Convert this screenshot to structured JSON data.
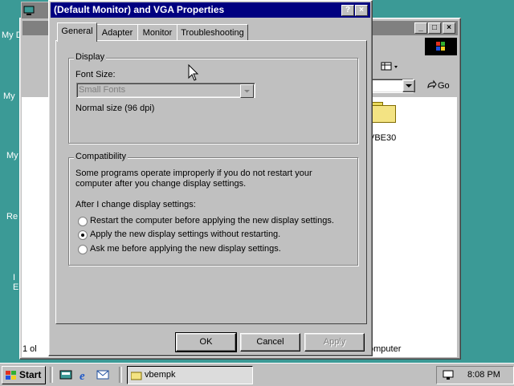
{
  "desktop": {
    "labels": [
      "My D",
      "My",
      "My",
      "Re",
      "I",
      "E"
    ]
  },
  "explorer": {
    "go_label": "Go",
    "folder_label": "VBE30",
    "status_left": "1 ol",
    "status_right": "omputer"
  },
  "dialog": {
    "title": "(Default Monitor) and VGA Properties",
    "help_btn": "?",
    "close_btn": "×",
    "tabs": [
      "General",
      "Adapter",
      "Monitor",
      "Troubleshooting"
    ],
    "display": {
      "group_title": "Display",
      "font_size_label": "Font Size:",
      "font_size_value": "Small Fonts",
      "normal_size": "Normal size (96 dpi)"
    },
    "compat": {
      "group_title": "Compatibility",
      "line1": "Some programs operate improperly if you do not restart your",
      "line2": "computer after you change display settings.",
      "after_label": "After I change display settings:",
      "options": [
        "Restart the computer before applying the new display settings.",
        "Apply the new display settings without restarting.",
        "Ask me before applying the new display settings."
      ]
    },
    "buttons": {
      "ok": "OK",
      "cancel": "Cancel",
      "apply": "Apply"
    }
  },
  "taskbar": {
    "start_label": "Start",
    "task_label": "vbempk",
    "clock": "8:08 PM"
  }
}
